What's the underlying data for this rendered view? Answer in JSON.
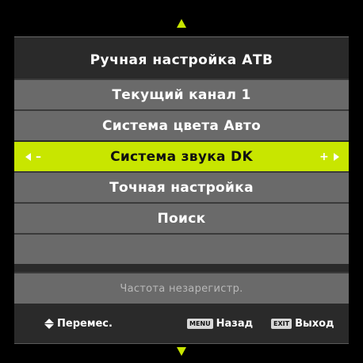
{
  "menu": {
    "title": "Ручная настройка АТВ",
    "rows": [
      {
        "label": "Текущий канал 1"
      },
      {
        "label": "Система цвета Авто"
      },
      {
        "label": "Система звука DK",
        "left": "–",
        "right": "+"
      },
      {
        "label": "Точная настройка"
      },
      {
        "label": "Поиск"
      },
      {
        "label": ""
      },
      {
        "label": "Частота незарегистр."
      }
    ]
  },
  "footer": {
    "move_label": "Перемес.",
    "menu_key": "MENU",
    "back_label": "Назад",
    "exit_key": "EXIT",
    "exit_label": "Выход"
  },
  "colors": {
    "accent": "#c8e600",
    "row": "#6a6a6a",
    "panel": "#2a2a2a"
  },
  "icons": [
    "arrow-up-icon",
    "arrow-down-icon",
    "left-arrow-icon",
    "right-arrow-icon",
    "updown-icon"
  ]
}
